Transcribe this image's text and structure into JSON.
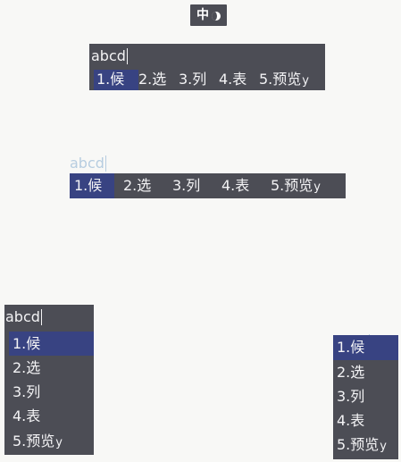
{
  "status": {
    "mode_label": "中",
    "icon": "moon-icon"
  },
  "preedit_text": "abcd",
  "candidates": [
    {
      "index": "1.",
      "text": "候",
      "suffix": ""
    },
    {
      "index": "2.",
      "text": "选",
      "suffix": ""
    },
    {
      "index": "3.",
      "text": "列",
      "suffix": ""
    },
    {
      "index": "4.",
      "text": "表",
      "suffix": ""
    },
    {
      "index": "5.",
      "text": "预览",
      "suffix": "y"
    }
  ],
  "colors": {
    "panel": "#4c4d55",
    "highlight": "#384382",
    "text": "#f3f3f5",
    "preedit_light": "#b7cde0",
    "page": "#f8f8f6"
  }
}
